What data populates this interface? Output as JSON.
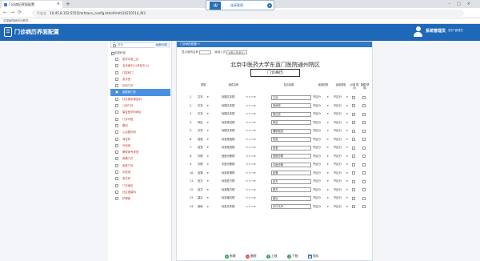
{
  "browser": {
    "tab_title": "门诊病历界面配置",
    "url_security": "不安全",
    "url": "10.45.8.152:5555/mrhtace_config.html#/mtc20210514_f63",
    "bookmark_text": "中国医院病历诊断学…",
    "float_title": "连接管理"
  },
  "header": {
    "title": "门诊病历界面配置",
    "system": "系统管理员",
    "user": "您好!管理员"
  },
  "sidebar": {
    "search_placeholder": "搜索",
    "search_button": "刷新列表",
    "root": "全部科室",
    "items": [
      {
        "label": "医学中医二区",
        "selected": false
      },
      {
        "label": "治未病中心(体检中心)",
        "selected": false
      },
      {
        "label": "口腔科门",
        "selected": false
      },
      {
        "label": "急诊室",
        "selected": false
      },
      {
        "label": "妇科门诊",
        "selected": false
      },
      {
        "label": "皮肤科门诊",
        "selected": true
      },
      {
        "label": "针灸推拿康复科",
        "selected": false
      },
      {
        "label": "儿科门诊",
        "selected": false
      },
      {
        "label": "康复医学科病区",
        "selected": false
      },
      {
        "label": "门诊中医",
        "selected": false
      },
      {
        "label": "眼科",
        "selected": false
      },
      {
        "label": "心血管内科",
        "selected": false
      },
      {
        "label": "消化科",
        "selected": false
      },
      {
        "label": "外科室",
        "selected": false
      },
      {
        "label": "脾胃病专家室",
        "selected": false
      },
      {
        "label": "肿瘤门诊",
        "selected": false
      },
      {
        "label": "皮肤门诊",
        "selected": false
      },
      {
        "label": "中医室",
        "selected": false
      },
      {
        "label": "急诊科",
        "selected": false
      },
      {
        "label": "门诊病区",
        "selected": false
      },
      {
        "label": "社区健康科",
        "selected": false
      },
      {
        "label": "护理部",
        "selected": false
      }
    ]
  },
  "main": {
    "panel_title": "门诊病历配置 ✎",
    "toolbar": {
      "show_label": "显示医院名称",
      "use_label": "使用人员",
      "use_value": "全部人员(默认)"
    },
    "hospital": "北京中医药大学东直门医院通州院区",
    "department": "门诊病历",
    "columns": [
      "类型",
      "组件名称",
      "显示标题",
      "适用性别",
      "适用类型",
      "必填 框内",
      "隐藏 移除"
    ],
    "rows": [
      {
        "no": "1.",
        "type": "文本",
        "comp": "标题文本框",
        "title": "主诉",
        "sex": "不区分",
        "kind": "不区分"
      },
      {
        "no": "2.",
        "type": "文本",
        "comp": "标题文本框",
        "title": "现病史",
        "sex": "不区分",
        "kind": "不区分"
      },
      {
        "no": "3.",
        "type": "文本",
        "comp": "标题文本框",
        "title": "既往史",
        "sex": "不区分",
        "kind": "不区分"
      },
      {
        "no": "4.",
        "type": "体征",
        "comp": "标准体征框",
        "title": "体征",
        "sex": "不区分",
        "kind": "不区分"
      },
      {
        "no": "5.",
        "type": "文本",
        "comp": "标题文本框",
        "title": "辅助检查",
        "sex": "不区分",
        "kind": "不区分"
      },
      {
        "no": "6.",
        "type": "检验",
        "comp": "标准检验框",
        "title": "检验",
        "sex": "不区分",
        "kind": "不区分"
      },
      {
        "no": "7.",
        "type": "检查",
        "comp": "标准检查框",
        "title": "检查",
        "sex": "不区分",
        "kind": "不区分"
      },
      {
        "no": "8.",
        "type": "诊断",
        "comp": "西医诊断框",
        "title": "西医诊断",
        "sex": "不区分",
        "kind": "不区分"
      },
      {
        "no": "9.",
        "type": "诊断",
        "comp": "中医诊断框",
        "title": "中医诊断",
        "sex": "不区分",
        "kind": "不区分"
      },
      {
        "no": "10.",
        "type": "处置",
        "comp": "标准处置框",
        "title": "处置",
        "sex": "不区分",
        "kind": "不区分"
      },
      {
        "no": "11.",
        "type": "处方",
        "comp": "标准处方框",
        "title": "处方",
        "sex": "不区分",
        "kind": "不区分"
      },
      {
        "no": "12.",
        "type": "处方",
        "comp": "标准配方框",
        "title": "配方",
        "sex": "不区分",
        "kind": "不区分"
      },
      {
        "no": "13.",
        "type": "建议",
        "comp": "标准建议框",
        "title": "建议",
        "sex": "不区分",
        "kind": "不区分"
      },
      {
        "no": "14.",
        "type": "其他",
        "comp": "标准文本框",
        "title": "诊疗文本",
        "sex": "不区分",
        "kind": "不区分"
      }
    ],
    "footer": {
      "add": "新增",
      "delete": "删除",
      "up": "上移",
      "down": "下移",
      "save": "保存"
    }
  }
}
